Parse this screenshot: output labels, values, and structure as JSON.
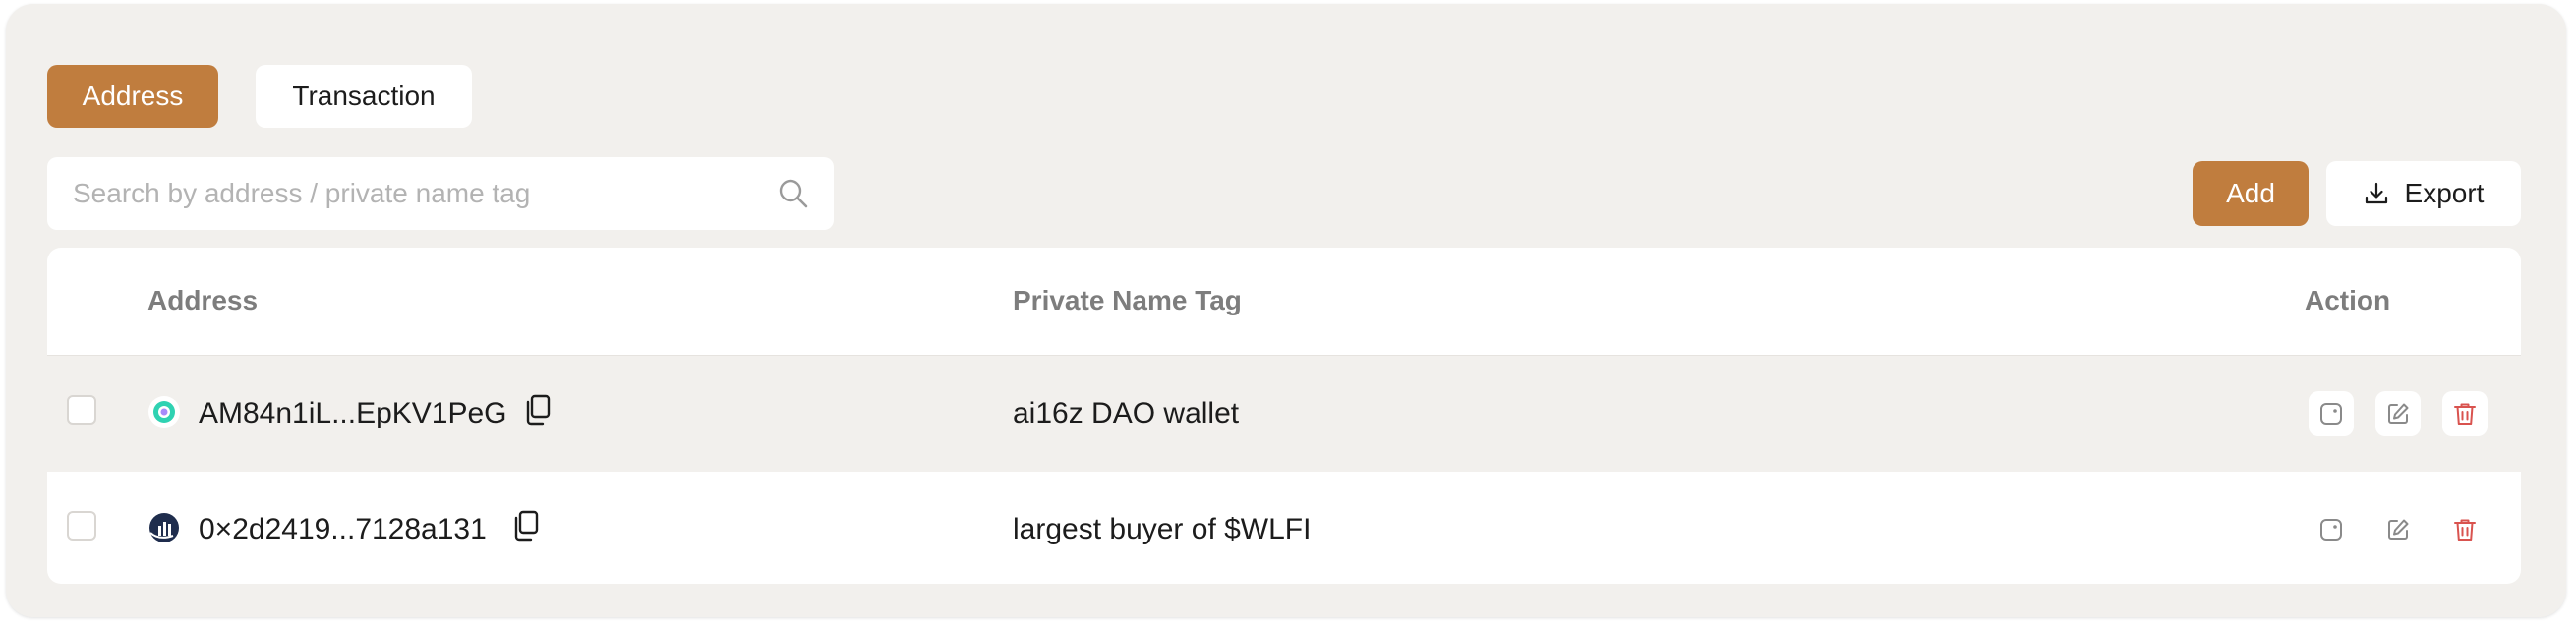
{
  "tabs": {
    "address": "Address",
    "transaction": "Transaction"
  },
  "search": {
    "placeholder": "Search by address / private name tag",
    "value": ""
  },
  "toolbar": {
    "add_label": "Add",
    "export_label": "Export"
  },
  "table": {
    "columns": {
      "address": "Address",
      "private_name_tag": "Private Name Tag",
      "action": "Action"
    },
    "rows": [
      {
        "address": "AM84n1iL...EpKV1PeG",
        "private_name_tag": "ai16z DAO wallet",
        "avatar_icon": "circle-target-icon"
      },
      {
        "address": "0×2d2419...7128a131",
        "private_name_tag": "largest buyer of $WLFI",
        "avatar_icon": "chart-logo-icon"
      }
    ]
  },
  "colors": {
    "accent": "#c07d3e",
    "panel_bg": "#f2f0ed",
    "delete_red": "#d9534f"
  }
}
